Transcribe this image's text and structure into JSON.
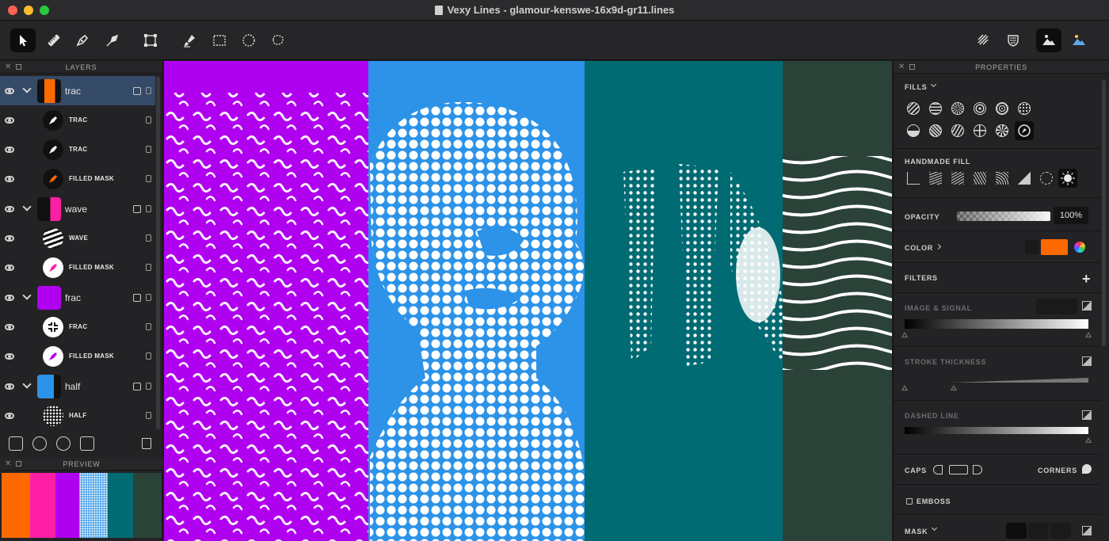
{
  "window": {
    "title": "Vexy Lines - glamour-kenswe-16x9d-gr11.lines"
  },
  "toolbar": {
    "left_tools": [
      "select-tool",
      "ruler-tool",
      "pen-tool",
      "line-pen-tool",
      "transform-tool",
      "brush-tool",
      "rect-select-tool",
      "ellipse-select-tool",
      "lasso-select-tool"
    ],
    "right_tools": [
      "lines-view",
      "shield-view",
      "mixed-view",
      "image-view"
    ]
  },
  "layers": {
    "title": "LAYERS",
    "items": [
      {
        "name": "trac",
        "type": "group",
        "selected": true
      },
      {
        "name": "TRAC",
        "type": "fill"
      },
      {
        "name": "TRAC",
        "type": "fill"
      },
      {
        "name": "FILLED MASK",
        "type": "mask"
      },
      {
        "name": "wave",
        "type": "group"
      },
      {
        "name": "WAVE",
        "type": "fill"
      },
      {
        "name": "FILLED MASK",
        "type": "mask"
      },
      {
        "name": "frac",
        "type": "group"
      },
      {
        "name": "FRAC",
        "type": "fill"
      },
      {
        "name": "FILLED MASK",
        "type": "mask"
      },
      {
        "name": "half",
        "type": "group"
      },
      {
        "name": "HALF",
        "type": "fill"
      }
    ]
  },
  "preview": {
    "title": "PREVIEW"
  },
  "properties": {
    "title": "PROPERTIES",
    "fills_label": "FILLS",
    "handmade_label": "HANDMADE FILL",
    "opacity_label": "OPACITY",
    "opacity_value": "100%",
    "color_label": "COLOR",
    "color_value": "#ff6a00",
    "filters_label": "FILTERS",
    "image_signal_label": "IMAGE & SIGNAL",
    "stroke_label": "STROKE THICKNESS",
    "dashed_label": "DASHED LINE",
    "caps_label": "CAPS",
    "corners_label": "CORNERS",
    "emboss_label": "EMBOSS",
    "mask_label": "MASK"
  },
  "colors": {
    "accent_selected": "#344a66",
    "panel_purple": "#b000f0",
    "panel_blue": "#2c93e8",
    "panel_teal": "#006b73",
    "panel_green": "#2a4238",
    "orange": "#ff6a00",
    "magenta": "#ff1fa5"
  }
}
